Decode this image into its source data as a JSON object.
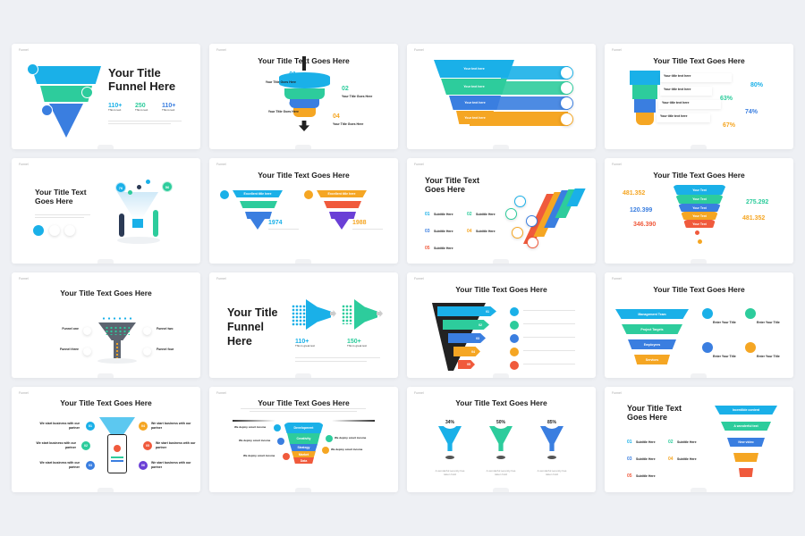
{
  "colors": {
    "cyan": "#1ab0e8",
    "green": "#2dcc9c",
    "blue": "#3a7ee0",
    "orange": "#f5a623",
    "red": "#f05a3c",
    "purple": "#6a3fd6",
    "background": "#eef0f4"
  },
  "slide_label": "Funnel",
  "s1": {
    "title1": "Your Title",
    "title2": "Funnel Here",
    "stats": [
      {
        "v": "110+",
        "l": "This is text"
      },
      {
        "v": "250",
        "l": "This is text"
      },
      {
        "v": "110+",
        "l": "This is text"
      }
    ],
    "icons": [
      "clock-icon",
      "gear-icon",
      "heart-icon"
    ]
  },
  "s2": {
    "title": "Your Title Text Goes Here",
    "items": [
      {
        "n": "01",
        "t": "Your Title Goes Here"
      },
      {
        "n": "02",
        "t": "Your Title Goes Here"
      },
      {
        "n": "03",
        "t": "Your Title Goes Here"
      },
      {
        "n": "04",
        "t": "Your Title Goes Here"
      }
    ]
  },
  "s3": {
    "items": [
      "Your text here",
      "Your text here",
      "Your text here",
      "Your text here"
    ]
  },
  "s4": {
    "title": "Your Title Text Goes Here",
    "rows": [
      {
        "t": "Your title text here",
        "p": "80%"
      },
      {
        "t": "Your title text here",
        "p": "63%"
      },
      {
        "t": "Your title text here",
        "p": "74%"
      },
      {
        "t": "Your title text here",
        "p": "67%"
      }
    ]
  },
  "s5": {
    "title1": "Your Title Text",
    "title2": "Goes Here",
    "badges": [
      "76",
      "56"
    ]
  },
  "s6": {
    "title": "Your Title Text Goes Here",
    "years": [
      "1974",
      "1988"
    ],
    "bar": "Excellent title here"
  },
  "s7": {
    "title1": "Your Title Text",
    "title2": "Goes Here",
    "items": [
      {
        "n": "01",
        "t": "Subtitle Here"
      },
      {
        "n": "02",
        "t": "Subtitle Here"
      },
      {
        "n": "03",
        "t": "Subtitle Here"
      },
      {
        "n": "04",
        "t": "Subtitle Here"
      },
      {
        "n": "05",
        "t": "Subtitle Here"
      }
    ]
  },
  "s8": {
    "title": "Your Title Text Goes Here",
    "left": [
      "481.352",
      "120.399",
      "346.390"
    ],
    "right": [
      "275.292",
      "481.352"
    ],
    "band": "Your Text"
  },
  "s9": {
    "title": "Your Title Text Goes Here",
    "labels": [
      "Funnel one",
      "Funnel two",
      "Funnel three",
      "Funnel four"
    ]
  },
  "s10": {
    "title1": "Your Title",
    "title2": "Funnel",
    "title3": "Here",
    "stats": [
      {
        "v": "110+",
        "l": "This is great text"
      },
      {
        "v": "150+",
        "l": "This is great text"
      }
    ]
  },
  "s11": {
    "title": "Your Title Text Goes Here",
    "steps": [
      "01",
      "02",
      "03",
      "04",
      "05"
    ]
  },
  "s12": {
    "title": "Your Title Text Goes Here",
    "bars": [
      "Management Team",
      "Project Targets",
      "Employees",
      "Services"
    ],
    "entry": "Enter Your Title"
  },
  "s13": {
    "title": "Your Title Text Goes Here",
    "item": "We start business with our partner",
    "steps": [
      "01",
      "02",
      "03",
      "04",
      "05",
      "06"
    ]
  },
  "s14": {
    "title": "Your Title Text Goes Here",
    "bands": [
      "Development",
      "Creativity",
      "Strategy",
      "Market",
      "Data"
    ],
    "label": "We deploy smart income"
  },
  "s15": {
    "title": "Your Title Text Goes Here",
    "values": [
      "34%",
      "50%",
      "85%"
    ],
    "caption": "A wonderful serenity has taken hold"
  },
  "s16": {
    "title1": "Your Title Text",
    "title2": "Goes Here",
    "items": [
      {
        "n": "01",
        "t": "Subtitle Here"
      },
      {
        "n": "02",
        "t": "Subtitle Here"
      },
      {
        "n": "03",
        "t": "Subtitle Here"
      },
      {
        "n": "04",
        "t": "Subtitle Here"
      },
      {
        "n": "05",
        "t": "Subtitle Here"
      }
    ],
    "bars": [
      "Incredible content",
      "A wonderful text",
      "New video"
    ]
  }
}
